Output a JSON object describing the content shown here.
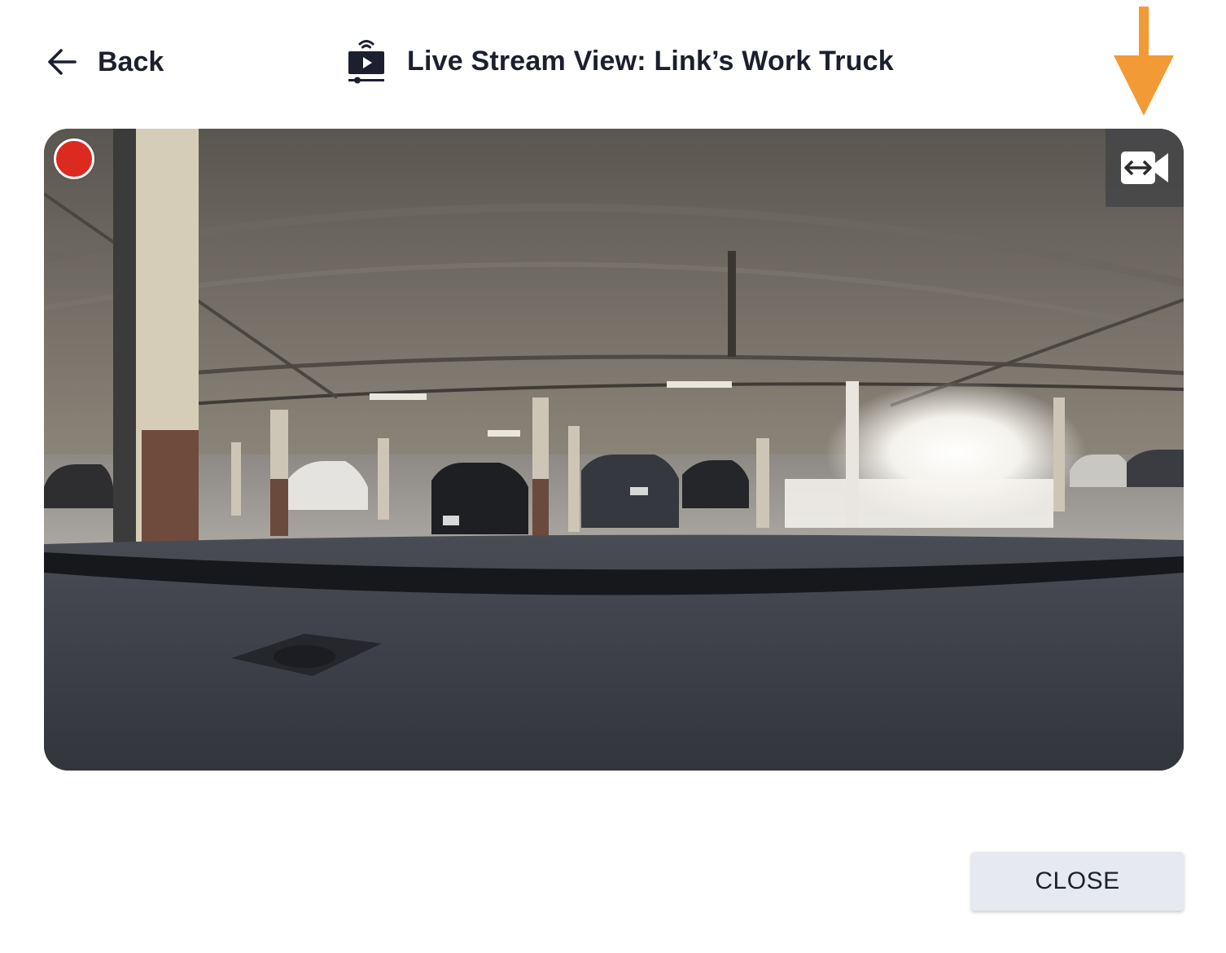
{
  "header": {
    "back_label": "Back",
    "title": "Live Stream View: Link’s Work Truck",
    "title_icon": "live-stream-icon",
    "back_icon": "arrow-left-icon"
  },
  "annotation": {
    "icon": "arrow-down-icon",
    "color": "#f29a35"
  },
  "video": {
    "recording_indicator": "record-icon",
    "recording_color": "#dc2a20",
    "switch_camera_icon": "switch-camera-icon",
    "description_icon": "dashcam-feed"
  },
  "footer": {
    "close_label": "CLOSE"
  }
}
